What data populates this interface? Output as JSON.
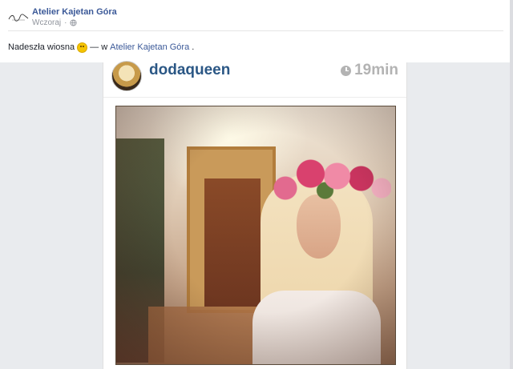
{
  "post": {
    "page_name": "Atelier Kajetan Góra",
    "timestamp": "Wczoraj",
    "audience_icon": "globe-icon",
    "logo_icon": "signature-logo-icon",
    "status_text": "Nadeszła wiosna",
    "emoji": "smile-emoji",
    "separator": "— w",
    "place": "Atelier Kajetan Góra",
    "period": "."
  },
  "instagram": {
    "username": "dodaqueen",
    "time_ago": "19min",
    "time_icon": "clock-icon"
  },
  "colors": {
    "link": "#3b5998",
    "ig_username": "#2b5785",
    "ig_time": "#b3b3b3",
    "photo_background": "#e9ebee"
  }
}
